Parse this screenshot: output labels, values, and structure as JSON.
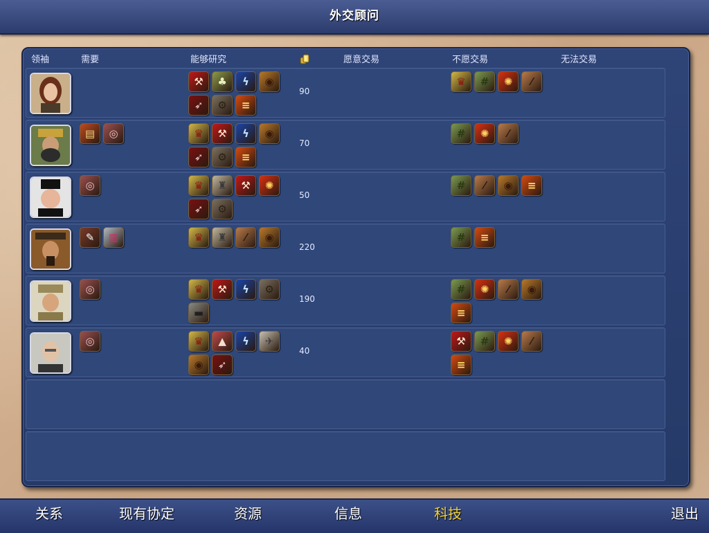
{
  "title": "外交顾问",
  "headers": {
    "leader": "领袖",
    "need": "需要",
    "can_research": "能够研究",
    "willing": "愿意交易",
    "unwilling": "不愿交易",
    "cannot": "无法交易"
  },
  "rows": [
    {
      "gold": "90",
      "need": [],
      "can": [
        "hammer-sickle-icon",
        "farm-icon",
        "electric-icon",
        "cannon-icon",
        "rifle-icon",
        "gears-icon",
        "furnace-icon"
      ],
      "unwilling": [
        "crown-icon",
        "grid-icon",
        "fire-icon",
        "musket-icon"
      ]
    },
    {
      "gold": "70",
      "need": [
        "book-icon",
        "yarn-icon"
      ],
      "can": [
        "crown-icon",
        "hammer-sickle-icon",
        "electric-icon",
        "cannon-icon",
        "rifle-icon",
        "gears-icon",
        "furnace-icon"
      ],
      "unwilling": [
        "grid-icon",
        "fire-icon",
        "musket-icon"
      ]
    },
    {
      "gold": "50",
      "need": [
        "yarn-icon"
      ],
      "can": [
        "crown-icon",
        "suit-icon",
        "hammer-sickle-icon",
        "fire-icon",
        "rifle-icon",
        "gears-icon"
      ],
      "unwilling": [
        "grid-icon",
        "musket-icon",
        "cannon-icon",
        "furnace-icon"
      ]
    },
    {
      "gold": "220",
      "need": [
        "quill-icon",
        "prism-icon"
      ],
      "can": [
        "crown-icon",
        "suit-icon",
        "musket-icon",
        "cannon-icon"
      ],
      "unwilling": [
        "grid-icon",
        "furnace-icon"
      ]
    },
    {
      "gold": "190",
      "need": [
        "yarn-icon"
      ],
      "can": [
        "crown-icon",
        "hammer-sickle-icon",
        "electric-icon",
        "gears-icon",
        "locomotive-icon"
      ],
      "unwilling": [
        "grid-icon",
        "fire-icon",
        "musket-icon",
        "cannon-icon",
        "furnace-icon"
      ]
    },
    {
      "gold": "40",
      "need": [
        "yarn-icon"
      ],
      "can": [
        "crown-icon",
        "anvil-icon",
        "electric-icon",
        "airplane-icon",
        "cannon-icon",
        "rifle-icon"
      ],
      "unwilling": [
        "hammer-sickle-icon",
        "grid-icon",
        "fire-icon",
        "musket-icon",
        "furnace-icon"
      ]
    }
  ],
  "nav": {
    "relations": "关系",
    "agreements": "现有协定",
    "resources": "资源",
    "info": "信息",
    "tech": "科技",
    "exit": "退出"
  },
  "colors": {
    "accent_active": "#f2d23a",
    "panel": "#2f4477",
    "bar": "#3c5088"
  }
}
